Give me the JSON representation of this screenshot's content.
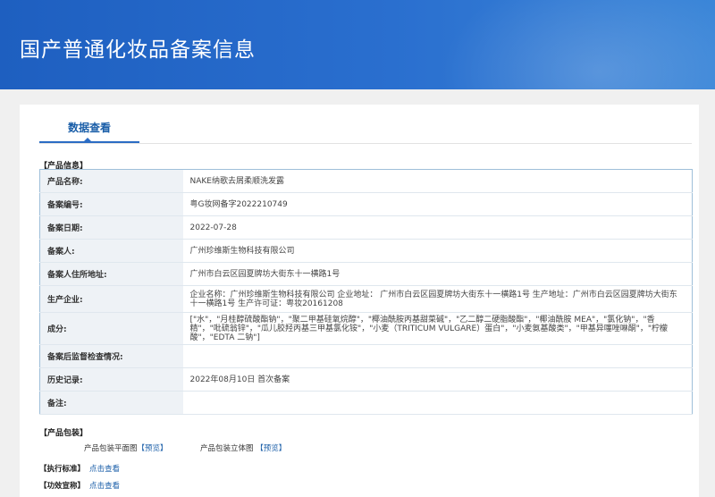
{
  "header": {
    "title": "国产普通化妆品备案信息"
  },
  "tab": {
    "label": "数据查看"
  },
  "product_info": {
    "section_title": "【产品信息】",
    "rows": [
      {
        "label": "产品名称:",
        "value": "NAKE纳歌去屑柔顺洗发露"
      },
      {
        "label": "备案编号:",
        "value": "粤G妆网备字2022210749"
      },
      {
        "label": "备案日期:",
        "value": "2022-07-28"
      },
      {
        "label": "备案人:",
        "value": "广州珍维斯生物科技有限公司"
      },
      {
        "label": "备案人住所地址:",
        "value": "广州市白云区园夏牌坊大街东十一横路1号"
      },
      {
        "label": "生产企业:",
        "value": "企业名称：广州珍维斯生物科技有限公司 企业地址： 广州市白云区园夏牌坊大街东十一横路1号 生产地址：广州市白云区园夏牌坊大街东十一横路1号 生产许可证：粤妆20161208"
      },
      {
        "label": "成分:",
        "value": "[\"水\"，\"月桂醇硫酸酯钠\"，\"聚二甲基硅氧烷醇\"，\"椰油酰胺丙基甜菜碱\"，\"乙二醇二硬脂酸酯\"，\"椰油酰胺 MEA\"，\"氯化钠\"，\"香精\"，\"吡硫翁锌\"，\"瓜儿胶羟丙基三甲基氯化铵\"，\"小麦（TRITICUM VULGARE）蛋白\"，\"小麦氨基酸类\"，\"甲基异噻唑啉酮\"，\"柠檬酸\"，\"EDTA 二钠\"]"
      },
      {
        "label": "备案后监督检查情况:",
        "value": ""
      },
      {
        "label": "历史记录:",
        "value": "2022年08月10日 首次备案"
      },
      {
        "label": "备注:",
        "value": ""
      }
    ]
  },
  "packaging": {
    "section_title": "【产品包装】",
    "flat_label": "产品包装平面图",
    "flat_link": "【预览】",
    "stereo_label": "产品包装立体图",
    "stereo_link": "【预览】"
  },
  "standard": {
    "label": "【执行标准】",
    "link": "点击查看"
  },
  "efficacy": {
    "label": "【功效宣称】",
    "link": "点击查看"
  }
}
